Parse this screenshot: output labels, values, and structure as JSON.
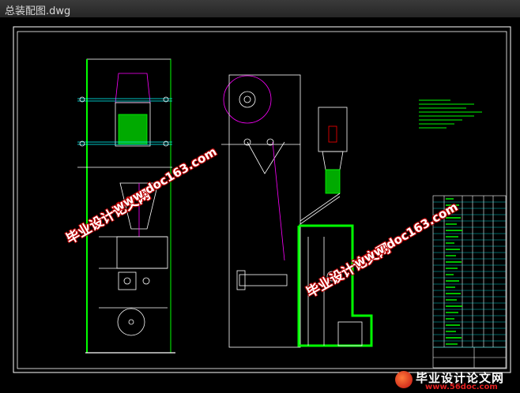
{
  "window": {
    "title": "总装配图.dwg"
  },
  "watermarks": {
    "site_cn": "毕业设计论文网",
    "site_url": "www.doc163.com"
  },
  "footer_logo": {
    "name": "毕业设计论文网",
    "url": "www.56doc.com"
  },
  "colors": {
    "background": "#000000",
    "frame": "#ffffff",
    "frame_green": "#00ff00",
    "magenta": "#ff00ff",
    "cyan": "#00ffff",
    "yellow": "#ffff00",
    "watermark_outline": "#bb0000"
  }
}
